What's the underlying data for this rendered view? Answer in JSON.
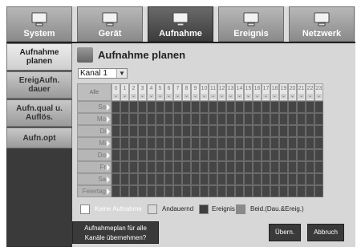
{
  "nav": {
    "tabs": [
      {
        "label": "System",
        "icon": "computer-icon",
        "active": false
      },
      {
        "label": "Gerät",
        "icon": "camera-icon",
        "active": false
      },
      {
        "label": "Aufnahme",
        "icon": "recorder-icon",
        "active": true
      },
      {
        "label": "Ereignis",
        "icon": "network-camera-icon",
        "active": false
      },
      {
        "label": "Netzwerk",
        "icon": "network-icon",
        "active": false
      }
    ]
  },
  "sidebar": {
    "items": [
      {
        "label": "Aufnahme planen",
        "active": true
      },
      {
        "label": "EreigAufn. dauer",
        "active": false
      },
      {
        "label": "Aufn.qual u. Auflös.",
        "active": false
      },
      {
        "label": "Aufn.opt",
        "active": false
      }
    ]
  },
  "page": {
    "title": "Aufnahme planen",
    "channel": "Kanal 1",
    "grid_all_label": "Alle",
    "hours": [
      "0",
      "1",
      "2",
      "3",
      "4",
      "5",
      "6",
      "7",
      "8",
      "9",
      "10",
      "11",
      "12",
      "13",
      "14",
      "15",
      "16",
      "17",
      "18",
      "19",
      "20",
      "21",
      "22",
      "23"
    ],
    "days": [
      "So",
      "Mo",
      "Di",
      "Mi",
      "Do",
      "Fr",
      "Sa",
      "Feiertag"
    ]
  },
  "legend": {
    "items": [
      {
        "label": "Keine Aufnahme",
        "color": "#ffffff"
      },
      {
        "label": "Andauernd",
        "color": "#d9d9d9"
      },
      {
        "label": "Ereignis",
        "color": "#3f3f3f"
      },
      {
        "label": "Beid.(Dau.&Ereig.)",
        "color": "#8a8a8a"
      }
    ]
  },
  "buttons": {
    "apply_all_line1": "Aufnahmeplan für alle",
    "apply_all_line2": "Kanäle übernehmen?",
    "ok": "Übern.",
    "cancel": "Abbruch"
  },
  "colors": {
    "cell_event": "#454545",
    "active_tab": "#3c3c3c"
  }
}
